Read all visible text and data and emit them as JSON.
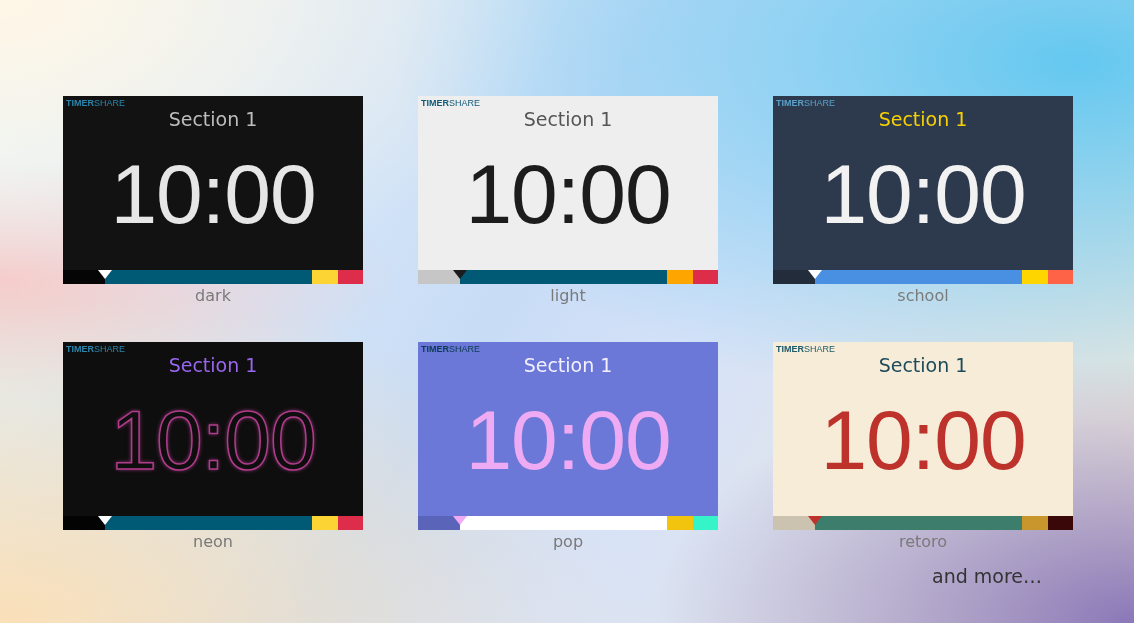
{
  "themes": [
    {
      "name": "dark",
      "logo": "**TIMER**SHARE",
      "section": "Section 1",
      "time": "10:00",
      "kind": "solid"
    },
    {
      "name": "light",
      "logo": "**TIMER**SHARE",
      "section": "Section 1",
      "time": "10:00",
      "kind": "solid"
    },
    {
      "name": "school",
      "logo": "**TIMER**SHARE",
      "section": "Section 1",
      "time": "10:00",
      "kind": "solid"
    },
    {
      "name": "neon",
      "logo": "**TIMER**SHARE",
      "section": "Section 1",
      "time": "10:00",
      "kind": "outline"
    },
    {
      "name": "pop",
      "logo": "**TIMER**SHARE",
      "section": "Section 1",
      "time": "10:00",
      "kind": "solid"
    },
    {
      "name": "retoro",
      "logo": "**TIMER**SHARE",
      "section": "Section 1",
      "time": "10:00",
      "kind": "solid"
    }
  ],
  "more": "and more…"
}
